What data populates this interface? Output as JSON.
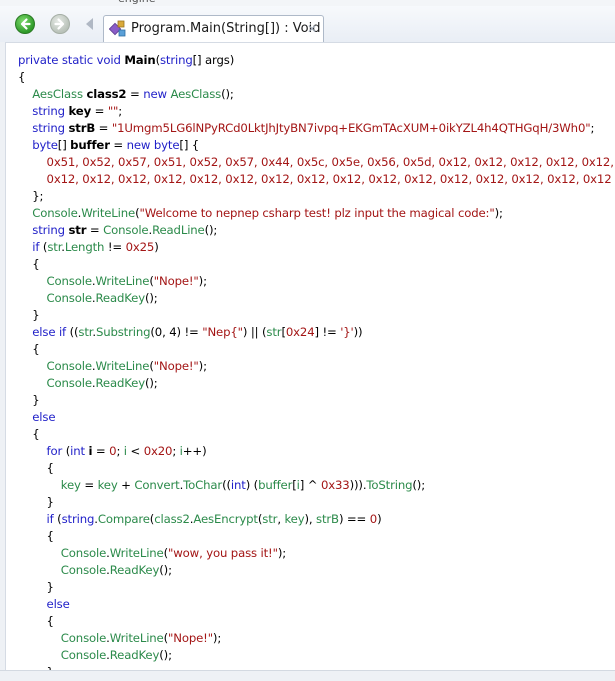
{
  "top_strip": {
    "text": "engine"
  },
  "tab": {
    "title": "Program.Main(String[]) : Void",
    "close": "✕"
  },
  "code_lines": [
    [
      [
        "kw",
        "private "
      ],
      [
        "kw",
        "static "
      ],
      [
        "kw",
        "void "
      ],
      [
        "id",
        "Main"
      ],
      [
        "pl",
        "("
      ],
      [
        "kw",
        "string"
      ],
      [
        "pl",
        "[] args)"
      ]
    ],
    [
      [
        "pl",
        "{"
      ]
    ],
    [
      [
        "pl",
        "    "
      ],
      [
        "ty",
        "AesClass "
      ],
      [
        "id",
        "class2"
      ],
      [
        "pl",
        " = "
      ],
      [
        "kw",
        "new "
      ],
      [
        "ty",
        "AesClass"
      ],
      [
        "pl",
        "();"
      ]
    ],
    [
      [
        "pl",
        "    "
      ],
      [
        "kw",
        "string "
      ],
      [
        "id",
        "key"
      ],
      [
        "pl",
        " = "
      ],
      [
        "str",
        "\"\""
      ],
      [
        "pl",
        ";"
      ]
    ],
    [
      [
        "pl",
        "    "
      ],
      [
        "kw",
        "string "
      ],
      [
        "id",
        "strB"
      ],
      [
        "pl",
        " = "
      ],
      [
        "str",
        "\"1Umgm5LG6lNPyRCd0LktJhJtyBN7ivpq+EKGmTAcXUM+0ikYZL4h4QTHGqH/3Wh0\""
      ],
      [
        "pl",
        ";"
      ]
    ],
    [
      [
        "pl",
        "    "
      ],
      [
        "kw",
        "byte"
      ],
      [
        "pl",
        "[] "
      ],
      [
        "id",
        "buffer"
      ],
      [
        "pl",
        " = "
      ],
      [
        "kw",
        "new "
      ],
      [
        "kw",
        "byte"
      ],
      [
        "pl",
        "[] {"
      ]
    ],
    [
      [
        "pl",
        "        "
      ],
      [
        "num",
        "0x51, 0x52, 0x57, 0x51, 0x52, 0x57, 0x44, 0x5c, 0x5e, 0x56, 0x5d, 0x12, 0x12, 0x12, 0x12, 0x12,"
      ]
    ],
    [
      [
        "pl",
        "        "
      ],
      [
        "num",
        "0x12, 0x12, 0x12, 0x12, 0x12, 0x12, 0x12, 0x12, 0x12, 0x12, 0x12, 0x12, 0x12, 0x12, 0x12, 0x12"
      ]
    ],
    [
      [
        "pl",
        "    };"
      ]
    ],
    [
      [
        "pl",
        "    "
      ],
      [
        "ty",
        "Console"
      ],
      [
        "pl",
        "."
      ],
      [
        "ty",
        "WriteLine"
      ],
      [
        "pl",
        "("
      ],
      [
        "str",
        "\"Welcome to nepnep csharp test! plz input the magical code:\""
      ],
      [
        "pl",
        ");"
      ]
    ],
    [
      [
        "pl",
        "    "
      ],
      [
        "kw",
        "string "
      ],
      [
        "id",
        "str"
      ],
      [
        "pl",
        " = "
      ],
      [
        "ty",
        "Console"
      ],
      [
        "pl",
        "."
      ],
      [
        "ty",
        "ReadLine"
      ],
      [
        "pl",
        "();"
      ]
    ],
    [
      [
        "pl",
        "    "
      ],
      [
        "kw",
        "if "
      ],
      [
        "pl",
        "("
      ],
      [
        "ty",
        "str"
      ],
      [
        "pl",
        "."
      ],
      [
        "ty",
        "Length"
      ],
      [
        "pl",
        " != "
      ],
      [
        "num",
        "0x25"
      ],
      [
        "pl",
        ")"
      ]
    ],
    [
      [
        "pl",
        "    {"
      ]
    ],
    [
      [
        "pl",
        "        "
      ],
      [
        "ty",
        "Console"
      ],
      [
        "pl",
        "."
      ],
      [
        "ty",
        "WriteLine"
      ],
      [
        "pl",
        "("
      ],
      [
        "str",
        "\"Nope!\""
      ],
      [
        "pl",
        ");"
      ]
    ],
    [
      [
        "pl",
        "        "
      ],
      [
        "ty",
        "Console"
      ],
      [
        "pl",
        "."
      ],
      [
        "ty",
        "ReadKey"
      ],
      [
        "pl",
        "();"
      ]
    ],
    [
      [
        "pl",
        "    }"
      ]
    ],
    [
      [
        "pl",
        "    "
      ],
      [
        "kw",
        "else if "
      ],
      [
        "pl",
        "(("
      ],
      [
        "ty",
        "str"
      ],
      [
        "pl",
        "."
      ],
      [
        "ty",
        "Substring"
      ],
      [
        "pl",
        "(0, 4) != "
      ],
      [
        "str",
        "\"Nep{\""
      ],
      [
        "pl",
        ") || ("
      ],
      [
        "ty",
        "str"
      ],
      [
        "pl",
        "["
      ],
      [
        "num",
        "0x24"
      ],
      [
        "pl",
        "] != "
      ],
      [
        "str",
        "'}'"
      ],
      [
        "pl",
        "))"
      ]
    ],
    [
      [
        "pl",
        "    {"
      ]
    ],
    [
      [
        "pl",
        "        "
      ],
      [
        "ty",
        "Console"
      ],
      [
        "pl",
        "."
      ],
      [
        "ty",
        "WriteLine"
      ],
      [
        "pl",
        "("
      ],
      [
        "str",
        "\"Nope!\""
      ],
      [
        "pl",
        ");"
      ]
    ],
    [
      [
        "pl",
        "        "
      ],
      [
        "ty",
        "Console"
      ],
      [
        "pl",
        "."
      ],
      [
        "ty",
        "ReadKey"
      ],
      [
        "pl",
        "();"
      ]
    ],
    [
      [
        "pl",
        "    }"
      ]
    ],
    [
      [
        "pl",
        "    "
      ],
      [
        "kw",
        "else"
      ]
    ],
    [
      [
        "pl",
        "    {"
      ]
    ],
    [
      [
        "pl",
        "        "
      ],
      [
        "kw",
        "for "
      ],
      [
        "pl",
        "("
      ],
      [
        "kw",
        "int "
      ],
      [
        "id",
        "i"
      ],
      [
        "pl",
        " = "
      ],
      [
        "num",
        "0"
      ],
      [
        "pl",
        "; "
      ],
      [
        "ty",
        "i"
      ],
      [
        "pl",
        " < "
      ],
      [
        "num",
        "0x20"
      ],
      [
        "pl",
        "; "
      ],
      [
        "ty",
        "i"
      ],
      [
        "pl",
        "++)"
      ]
    ],
    [
      [
        "pl",
        "        {"
      ]
    ],
    [
      [
        "pl",
        "            "
      ],
      [
        "ty",
        "key"
      ],
      [
        "pl",
        " = "
      ],
      [
        "ty",
        "key"
      ],
      [
        "pl",
        " + "
      ],
      [
        "ty",
        "Convert"
      ],
      [
        "pl",
        "."
      ],
      [
        "ty",
        "ToChar"
      ],
      [
        "pl",
        "(("
      ],
      [
        "kw",
        "int"
      ],
      [
        "pl",
        ") ("
      ],
      [
        "ty",
        "buffer"
      ],
      [
        "pl",
        "["
      ],
      [
        "ty",
        "i"
      ],
      [
        "pl",
        "] ^ "
      ],
      [
        "num",
        "0x33"
      ],
      [
        "pl",
        ")))."
      ],
      [
        "ty",
        "ToString"
      ],
      [
        "pl",
        "();"
      ]
    ],
    [
      [
        "pl",
        "        }"
      ]
    ],
    [
      [
        "pl",
        "        "
      ],
      [
        "kw",
        "if "
      ],
      [
        "pl",
        "("
      ],
      [
        "kw",
        "string"
      ],
      [
        "pl",
        "."
      ],
      [
        "ty",
        "Compare"
      ],
      [
        "pl",
        "("
      ],
      [
        "ty",
        "class2"
      ],
      [
        "pl",
        "."
      ],
      [
        "ty",
        "AesEncrypt"
      ],
      [
        "pl",
        "("
      ],
      [
        "ty",
        "str"
      ],
      [
        "pl",
        ", "
      ],
      [
        "ty",
        "key"
      ],
      [
        "pl",
        "), "
      ],
      [
        "ty",
        "strB"
      ],
      [
        "pl",
        ") == "
      ],
      [
        "num",
        "0"
      ],
      [
        "pl",
        ")"
      ]
    ],
    [
      [
        "pl",
        "        {"
      ]
    ],
    [
      [
        "pl",
        "            "
      ],
      [
        "ty",
        "Console"
      ],
      [
        "pl",
        "."
      ],
      [
        "ty",
        "WriteLine"
      ],
      [
        "pl",
        "("
      ],
      [
        "str",
        "\"wow, you pass it!\""
      ],
      [
        "pl",
        ");"
      ]
    ],
    [
      [
        "pl",
        "            "
      ],
      [
        "ty",
        "Console"
      ],
      [
        "pl",
        "."
      ],
      [
        "ty",
        "ReadKey"
      ],
      [
        "pl",
        "();"
      ]
    ],
    [
      [
        "pl",
        "        }"
      ]
    ],
    [
      [
        "pl",
        "        "
      ],
      [
        "kw",
        "else"
      ]
    ],
    [
      [
        "pl",
        "        {"
      ]
    ],
    [
      [
        "pl",
        "            "
      ],
      [
        "ty",
        "Console"
      ],
      [
        "pl",
        "."
      ],
      [
        "ty",
        "WriteLine"
      ],
      [
        "pl",
        "("
      ],
      [
        "str",
        "\"Nope!\""
      ],
      [
        "pl",
        ");"
      ]
    ],
    [
      [
        "pl",
        "            "
      ],
      [
        "ty",
        "Console"
      ],
      [
        "pl",
        "."
      ],
      [
        "ty",
        "ReadKey"
      ],
      [
        "pl",
        "();"
      ]
    ],
    [
      [
        "pl",
        "        }"
      ]
    ]
  ]
}
